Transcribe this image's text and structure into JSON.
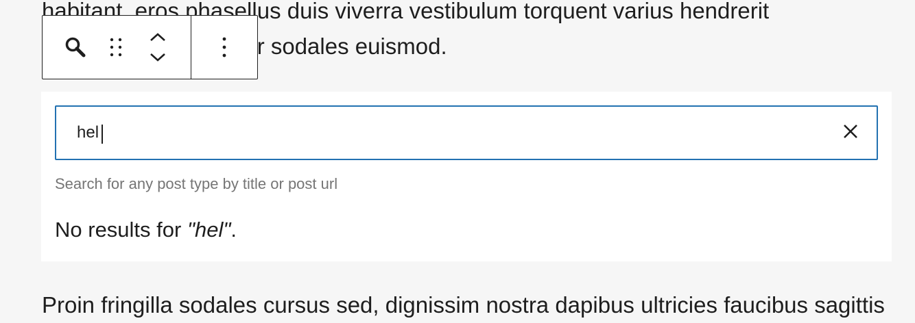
{
  "content": {
    "paragraph_top_line1": "habitant, eros phasellus duis viverra vestibulum torquent varius hendrerit",
    "paragraph_top_line2": "tincidunt nunc, tempor sodales euismod.",
    "paragraph_bottom": "Proin fringilla sodales cursus sed, dignissim nostra dapibus ultricies faucibus sagittis"
  },
  "toolbar": {
    "icons": [
      "search-icon",
      "drag-handle-icon",
      "chevron-up-icon",
      "chevron-down-icon",
      "more-vertical-icon"
    ]
  },
  "link_search": {
    "query": "hel",
    "help_text": "Search for any post type by title or post url",
    "no_results_prefix": "No results for ",
    "no_results_query": "\"hel\"",
    "no_results_suffix": "."
  },
  "colors": {
    "accent": "#2271b1",
    "text": "#1e1e1e",
    "muted": "#757575",
    "background": "#f6f6f6"
  }
}
